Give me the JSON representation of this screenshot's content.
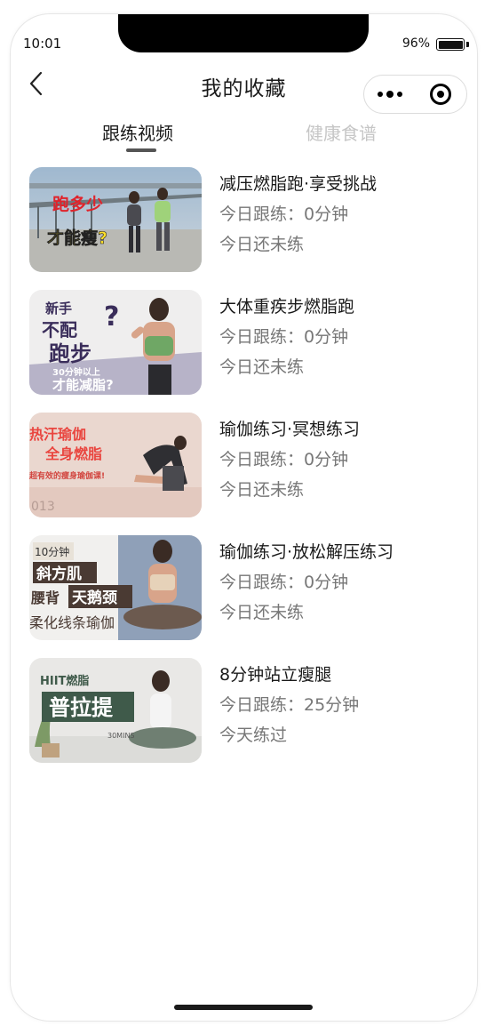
{
  "status_bar": {
    "time": "10:01",
    "battery": "96%"
  },
  "header": {
    "title": "我的收藏"
  },
  "tabs": [
    {
      "label": "跟练视频",
      "active": true
    },
    {
      "label": "健康食谱",
      "active": false
    }
  ],
  "videos": [
    {
      "title": "减压燃脂跑·享受挑战",
      "today": "今日跟练：0分钟",
      "status": "今日还未练",
      "thumb_text": [
        "跑多少",
        "才能瘦?"
      ]
    },
    {
      "title": "大体重疾步燃脂跑",
      "today": "今日跟练：0分钟",
      "status": "今日还未练",
      "thumb_text": [
        "新手",
        "不配",
        "跑步",
        "30分钟以上",
        "才能减脂?"
      ]
    },
    {
      "title": "瑜伽练习·冥想练习",
      "today": "今日跟练：0分钟",
      "status": "今日还未练",
      "thumb_text": [
        "热汗瑜伽",
        "全身燃脂",
        "超有效的瘦身瑜伽课!",
        "013"
      ]
    },
    {
      "title": "瑜伽练习·放松解压练习",
      "today": "今日跟练：0分钟",
      "status": "今日还未练",
      "thumb_text": [
        "10分钟",
        "斜方肌",
        "腰背",
        "天鹅颈",
        "柔化线条瑜伽"
      ]
    },
    {
      "title": "8分钟站立瘦腿",
      "today": "今日跟练：25分钟",
      "status": "今天练过",
      "thumb_text": [
        "HIIT燃脂",
        "普拉提",
        "30MINS"
      ]
    }
  ],
  "colors": {
    "active_tab": "#1a1a1a",
    "inactive_tab": "#c6c6c6",
    "subtext": "#777777"
  }
}
